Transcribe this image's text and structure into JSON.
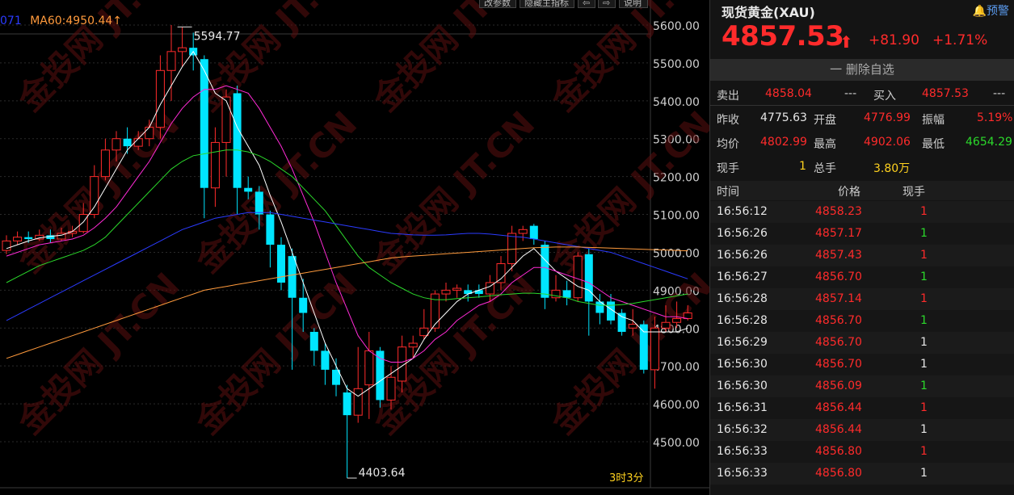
{
  "chart": {
    "toolbar": {
      "btn1": "改参数",
      "btn2": "隐藏主指标",
      "btn3": "⇦",
      "btn4": "⇨",
      "btn5": "说明"
    },
    "ma_label_prefix": "071",
    "ma60_label": "MA60:4950.44",
    "ma60_arrow": "↑",
    "high_label": "5594.77",
    "low_label": "4403.64",
    "period_label": "3时3分",
    "yaxis_ticks": [
      "5600.00",
      "5500.00",
      "5400.00",
      "5300.00",
      "5200.00",
      "5100.00",
      "5000.00",
      "4900.00",
      "4800.00",
      "4700.00",
      "4600.00",
      "4500.00"
    ],
    "watermark": "金投网 JT.CN",
    "colors": {
      "up": "#ff2b2b",
      "down": "#00e5ff",
      "ma5": "#ffffff",
      "ma10": "#ff2bd6",
      "ma20": "#2bd92b",
      "ma40": "#2b3bff",
      "ma60": "#ff9a3c"
    }
  },
  "chart_data": {
    "type": "candlestick",
    "ylim": [
      4440,
      5640
    ],
    "candles": [
      {
        "o": 5005,
        "c": 5030,
        "h": 5045,
        "l": 4995,
        "up": true
      },
      {
        "o": 5030,
        "c": 5040,
        "h": 5055,
        "l": 5020,
        "up": true
      },
      {
        "o": 5040,
        "c": 5035,
        "h": 5055,
        "l": 5025,
        "up": false
      },
      {
        "o": 5035,
        "c": 5045,
        "h": 5060,
        "l": 5030,
        "up": true
      },
      {
        "o": 5045,
        "c": 5035,
        "h": 5060,
        "l": 5025,
        "up": false
      },
      {
        "o": 5035,
        "c": 5050,
        "h": 5065,
        "l": 5030,
        "up": true
      },
      {
        "o": 5050,
        "c": 5055,
        "h": 5070,
        "l": 5040,
        "up": true
      },
      {
        "o": 5055,
        "c": 5100,
        "h": 5130,
        "l": 5050,
        "up": true
      },
      {
        "o": 5100,
        "c": 5200,
        "h": 5230,
        "l": 5090,
        "up": true
      },
      {
        "o": 5200,
        "c": 5270,
        "h": 5300,
        "l": 5190,
        "up": true
      },
      {
        "o": 5270,
        "c": 5300,
        "h": 5320,
        "l": 5240,
        "up": true
      },
      {
        "o": 5300,
        "c": 5280,
        "h": 5330,
        "l": 5260,
        "up": false
      },
      {
        "o": 5280,
        "c": 5300,
        "h": 5320,
        "l": 5270,
        "up": true
      },
      {
        "o": 5300,
        "c": 5330,
        "h": 5350,
        "l": 5280,
        "up": true
      },
      {
        "o": 5330,
        "c": 5480,
        "h": 5520,
        "l": 5300,
        "up": true
      },
      {
        "o": 5480,
        "c": 5530,
        "h": 5600,
        "l": 5400,
        "up": true
      },
      {
        "o": 5530,
        "c": 5540,
        "h": 5595,
        "l": 5490,
        "up": true
      },
      {
        "o": 5540,
        "c": 5520,
        "h": 5580,
        "l": 5480,
        "up": false
      },
      {
        "o": 5510,
        "c": 5170,
        "h": 5520,
        "l": 5090,
        "up": false
      },
      {
        "o": 5170,
        "c": 5290,
        "h": 5330,
        "l": 5120,
        "up": true
      },
      {
        "o": 5290,
        "c": 5410,
        "h": 5430,
        "l": 5200,
        "up": true
      },
      {
        "o": 5420,
        "c": 5170,
        "h": 5440,
        "l": 5100,
        "up": false
      },
      {
        "o": 5170,
        "c": 5160,
        "h": 5200,
        "l": 5140,
        "up": false
      },
      {
        "o": 5160,
        "c": 5100,
        "h": 5175,
        "l": 5060,
        "up": false
      },
      {
        "o": 5100,
        "c": 5020,
        "h": 5110,
        "l": 4960,
        "up": false
      },
      {
        "o": 5020,
        "c": 4920,
        "h": 5040,
        "l": 4900,
        "up": false
      },
      {
        "o": 4990,
        "c": 4880,
        "h": 5010,
        "l": 4690,
        "up": false
      },
      {
        "o": 4880,
        "c": 4840,
        "h": 4930,
        "l": 4790,
        "up": false
      },
      {
        "o": 4790,
        "c": 4740,
        "h": 4800,
        "l": 4700,
        "up": false
      },
      {
        "o": 4740,
        "c": 4690,
        "h": 4760,
        "l": 4650,
        "up": false
      },
      {
        "o": 4690,
        "c": 4650,
        "h": 4720,
        "l": 4620,
        "up": false
      },
      {
        "o": 4630,
        "c": 4570,
        "h": 4650,
        "l": 4404,
        "up": false
      },
      {
        "o": 4570,
        "c": 4640,
        "h": 4750,
        "l": 4550,
        "up": true
      },
      {
        "o": 4650,
        "c": 4740,
        "h": 4790,
        "l": 4560,
        "up": true
      },
      {
        "o": 4740,
        "c": 4610,
        "h": 4750,
        "l": 4590,
        "up": false
      },
      {
        "o": 4610,
        "c": 4670,
        "h": 4700,
        "l": 4585,
        "up": true
      },
      {
        "o": 4660,
        "c": 4750,
        "h": 4780,
        "l": 4630,
        "up": true
      },
      {
        "o": 4750,
        "c": 4760,
        "h": 4780,
        "l": 4720,
        "up": true
      },
      {
        "o": 4780,
        "c": 4800,
        "h": 4850,
        "l": 4770,
        "up": true
      },
      {
        "o": 4800,
        "c": 4890,
        "h": 4900,
        "l": 4790,
        "up": true
      },
      {
        "o": 4890,
        "c": 4900,
        "h": 4920,
        "l": 4870,
        "up": true
      },
      {
        "o": 4900,
        "c": 4905,
        "h": 4915,
        "l": 4880,
        "up": true
      },
      {
        "o": 4900,
        "c": 4890,
        "h": 4915,
        "l": 4870,
        "up": false
      },
      {
        "o": 4900,
        "c": 4890,
        "h": 4915,
        "l": 4880,
        "up": false
      },
      {
        "o": 4890,
        "c": 4920,
        "h": 4940,
        "l": 4870,
        "up": true
      },
      {
        "o": 4920,
        "c": 4970,
        "h": 4990,
        "l": 4900,
        "up": true
      },
      {
        "o": 4970,
        "c": 5050,
        "h": 5070,
        "l": 4950,
        "up": true
      },
      {
        "o": 5050,
        "c": 5060,
        "h": 5070,
        "l": 5030,
        "up": true
      },
      {
        "o": 5070,
        "c": 5035,
        "h": 5075,
        "l": 5020,
        "up": false
      },
      {
        "o": 5020,
        "c": 4880,
        "h": 5030,
        "l": 4850,
        "up": false
      },
      {
        "o": 4880,
        "c": 4900,
        "h": 4940,
        "l": 4870,
        "up": true
      },
      {
        "o": 4900,
        "c": 4880,
        "h": 4925,
        "l": 4860,
        "up": false
      },
      {
        "o": 4880,
        "c": 4990,
        "h": 5000,
        "l": 4870,
        "up": true
      },
      {
        "o": 4995,
        "c": 4870,
        "h": 5010,
        "l": 4780,
        "up": false
      },
      {
        "o": 4870,
        "c": 4840,
        "h": 4890,
        "l": 4810,
        "up": false
      },
      {
        "o": 4870,
        "c": 4820,
        "h": 4890,
        "l": 4810,
        "up": false
      },
      {
        "o": 4840,
        "c": 4790,
        "h": 4850,
        "l": 4780,
        "up": false
      },
      {
        "o": 4800,
        "c": 4810,
        "h": 4850,
        "l": 4780,
        "up": true
      },
      {
        "o": 4810,
        "c": 4690,
        "h": 4820,
        "l": 4680,
        "up": false
      },
      {
        "o": 4690,
        "c": 4800,
        "h": 4830,
        "l": 4640,
        "up": true
      },
      {
        "o": 4800,
        "c": 4815,
        "h": 4860,
        "l": 4790,
        "up": true
      },
      {
        "o": 4815,
        "c": 4825,
        "h": 4870,
        "l": 4800,
        "up": true
      },
      {
        "o": 4825,
        "c": 4840,
        "h": 4860,
        "l": 4820,
        "up": true
      }
    ],
    "ma_lines": {
      "ma5": [
        5010,
        5020,
        5030,
        5038,
        5042,
        5045,
        5055,
        5080,
        5120,
        5170,
        5220,
        5270,
        5300,
        5330,
        5390,
        5440,
        5490,
        5530,
        5480,
        5420,
        5400,
        5330,
        5280,
        5230,
        5150,
        5080,
        5000,
        4920,
        4840,
        4760,
        4700,
        4640,
        4620,
        4640,
        4660,
        4680,
        4700,
        4720,
        4770,
        4810,
        4840,
        4870,
        4890,
        4900,
        4910,
        4930,
        4960,
        4990,
        5010,
        4980,
        4950,
        4930,
        4910,
        4900,
        4870,
        4850,
        4830,
        4820,
        4790,
        4790,
        4790,
        4790,
        4800
      ],
      "ma10": [
        4990,
        5000,
        5010,
        5020,
        5025,
        5030,
        5035,
        5045,
        5065,
        5090,
        5120,
        5160,
        5200,
        5240,
        5290,
        5340,
        5380,
        5410,
        5430,
        5430,
        5440,
        5430,
        5420,
        5380,
        5330,
        5280,
        5220,
        5150,
        5080,
        5000,
        4920,
        4850,
        4780,
        4740,
        4720,
        4710,
        4710,
        4720,
        4740,
        4770,
        4790,
        4820,
        4840,
        4860,
        4870,
        4890,
        4920,
        4940,
        4960,
        4960,
        4950,
        4940,
        4930,
        4920,
        4900,
        4880,
        4870,
        4860,
        4850,
        4840,
        4830,
        4830,
        4825
      ],
      "ma20": [
        4920,
        4935,
        4950,
        4965,
        4975,
        4985,
        4995,
        5005,
        5020,
        5040,
        5070,
        5100,
        5130,
        5160,
        5190,
        5220,
        5240,
        5255,
        5260,
        5265,
        5270,
        5270,
        5265,
        5255,
        5240,
        5220,
        5200,
        5170,
        5140,
        5110,
        5070,
        5030,
        4990,
        4960,
        4940,
        4920,
        4905,
        4890,
        4880,
        4875,
        4875,
        4878,
        4880,
        4882,
        4885,
        4888,
        4890,
        4892,
        4892,
        4890,
        4885,
        4880,
        4870,
        4865,
        4860,
        4860,
        4862,
        4865,
        4870,
        4875,
        4880,
        4885,
        4890
      ],
      "ma40": [
        4820,
        4835,
        4850,
        4865,
        4880,
        4895,
        4910,
        4925,
        4940,
        4955,
        4970,
        4985,
        5000,
        5015,
        5030,
        5045,
        5060,
        5070,
        5080,
        5090,
        5095,
        5100,
        5105,
        5105,
        5105,
        5100,
        5095,
        5090,
        5085,
        5080,
        5075,
        5070,
        5065,
        5060,
        5055,
        5050,
        5048,
        5046,
        5045,
        5045,
        5046,
        5048,
        5050,
        5050,
        5048,
        5045,
        5042,
        5040,
        5035,
        5030,
        5025,
        5020,
        5015,
        5010,
        5005,
        5000,
        4990,
        4980,
        4970,
        4960,
        4950,
        4940,
        4930
      ],
      "ma60": [
        4720,
        4730,
        4740,
        4750,
        4760,
        4770,
        4780,
        4790,
        4800,
        4810,
        4820,
        4830,
        4840,
        4850,
        4860,
        4870,
        4880,
        4890,
        4900,
        4905,
        4910,
        4915,
        4920,
        4925,
        4930,
        4935,
        4940,
        4945,
        4950,
        4955,
        4960,
        4965,
        4970,
        4975,
        4980,
        4985,
        4988,
        4990,
        4992,
        4994,
        4996,
        4998,
        5000,
        5002,
        5004,
        5006,
        5008,
        5010,
        5012,
        5013,
        5014,
        5014,
        5014,
        5013,
        5012,
        5011,
        5010,
        5009,
        5008,
        5007,
        5006,
        5005,
        5004
      ]
    }
  },
  "quote": {
    "name": "现货黄金(XAU)",
    "alert_label": "预警",
    "price": "4857.53",
    "arrow": "⬆",
    "change": "+81.90",
    "change_pct": "+1.71%",
    "fav_label": "一 删除自选",
    "sell_label": "卖出",
    "sell_value": "4858.04",
    "sell_dash": "---",
    "buy_label": "买入",
    "buy_value": "4857.53",
    "buy_dash": "---",
    "prev_close_label": "昨收",
    "prev_close": "4775.63",
    "open_label": "开盘",
    "open": "4776.99",
    "amp_label": "振幅",
    "amp": "5.19%",
    "avg_label": "均价",
    "avg": "4802.99",
    "high_label": "最高",
    "high": "4902.06",
    "low_label": "最低",
    "low": "4654.29",
    "cur_hand_label": "现手",
    "cur_hand": "1",
    "total_hand_label": "总手",
    "total_hand": "3.80万"
  },
  "ticks": {
    "header": {
      "time": "时间",
      "price": "价格",
      "hand": "现手"
    },
    "rows": [
      {
        "time": "16:56:12",
        "price": "4858.23",
        "hand": "1",
        "hc": "red"
      },
      {
        "time": "16:56:26",
        "price": "4857.17",
        "hand": "1",
        "hc": "green"
      },
      {
        "time": "16:56:26",
        "price": "4857.43",
        "hand": "1",
        "hc": "red"
      },
      {
        "time": "16:56:27",
        "price": "4856.70",
        "hand": "1",
        "hc": "green"
      },
      {
        "time": "16:56:28",
        "price": "4857.14",
        "hand": "1",
        "hc": "red"
      },
      {
        "time": "16:56:28",
        "price": "4856.70",
        "hand": "1",
        "hc": "green"
      },
      {
        "time": "16:56:29",
        "price": "4856.70",
        "hand": "1",
        "hc": "white"
      },
      {
        "time": "16:56:30",
        "price": "4856.70",
        "hand": "1",
        "hc": "white"
      },
      {
        "time": "16:56:30",
        "price": "4856.09",
        "hand": "1",
        "hc": "green"
      },
      {
        "time": "16:56:31",
        "price": "4856.44",
        "hand": "1",
        "hc": "red"
      },
      {
        "time": "16:56:32",
        "price": "4856.44",
        "hand": "1",
        "hc": "white"
      },
      {
        "time": "16:56:33",
        "price": "4856.80",
        "hand": "1",
        "hc": "red"
      },
      {
        "time": "16:56:33",
        "price": "4856.80",
        "hand": "1",
        "hc": "white"
      }
    ]
  }
}
